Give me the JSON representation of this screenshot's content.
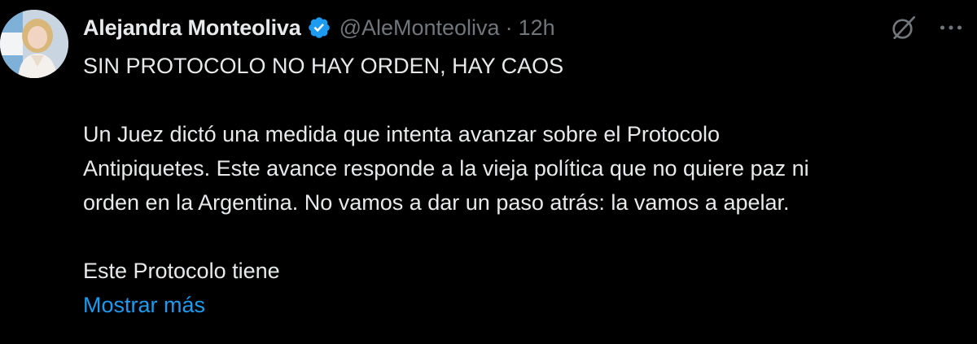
{
  "author": {
    "display_name": "Alejandra Monteoliva",
    "handle": "@AleMonteoliva",
    "separator": "·",
    "time": "12h",
    "verified": true,
    "avatar_icon": "profile-photo"
  },
  "icons": {
    "verified": "verified-badge-icon",
    "grok": "grok-icon",
    "more": "more-options-icon"
  },
  "colors": {
    "background": "#000000",
    "text": "#e7e9ea",
    "muted": "#71767b",
    "link": "#1d9bf0",
    "badge": "#1d9bf0"
  },
  "tweet": {
    "headline": "SIN PROTOCOLO NO HAY ORDEN, HAY CAOS",
    "paragraph_1_lines": [
      "Un Juez dictó una medida que intenta avanzar sobre el Protocolo",
      "Antipiquetes. Este avance responde a la vieja política que no quiere paz ni",
      "orden en la Argentina. No vamos a dar un paso atrás: la vamos a apelar."
    ],
    "paragraph_2": "Este Protocolo tiene",
    "show_more_label": "Mostrar más"
  }
}
